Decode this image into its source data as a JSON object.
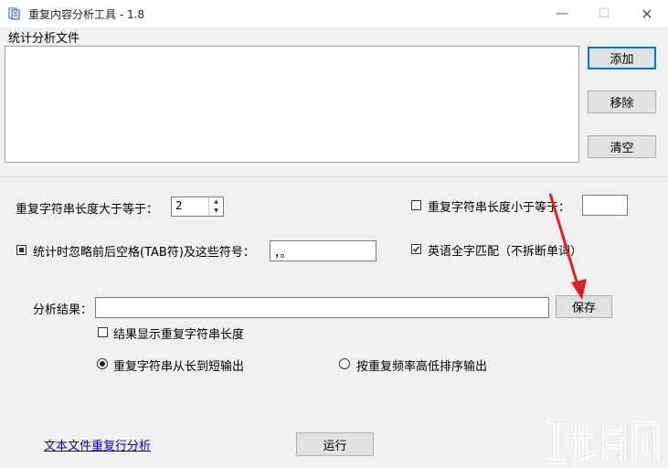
{
  "window": {
    "title": "重复内容分析工具 - 1.8",
    "min_glyph": "—",
    "max_glyph": "☐",
    "close_glyph": "✕"
  },
  "files": {
    "group_label": "统计分析文件",
    "add_label": "添加",
    "remove_label": "移除",
    "clear_label": "清空"
  },
  "options": {
    "min_length_label": "重复字符串长度大于等于：",
    "min_length_value": "2",
    "max_length_label": "重复字符串长度小于等于：",
    "max_length_checked": false,
    "ignore_label": "统计时忽略前后空格(TAB符)及这些符号：",
    "ignore_checked": true,
    "ignore_symbols": "，。",
    "whole_word_label": "英语全字匹配（不拆断单词）",
    "whole_word_checked": true
  },
  "result": {
    "label": "分析结果：",
    "save_label": "保存",
    "show_length_label": "结果显示重复字符串长度",
    "show_length_checked": false,
    "sort_by_length_label": "重复字符串从长到短输出",
    "sort_by_length_selected": true,
    "sort_by_frequency_label": "按重复频率高低排序输出",
    "sort_by_frequency_selected": false
  },
  "footer": {
    "link_label": "文本文件重复行分析",
    "run_label": "运行"
  },
  "colors": {
    "accent": "#0078d7",
    "arrow": "#e02020",
    "link": "#0000cc"
  },
  "icons": {
    "spin_up": "▲",
    "spin_down": "▼",
    "check_mark": "✓"
  }
}
